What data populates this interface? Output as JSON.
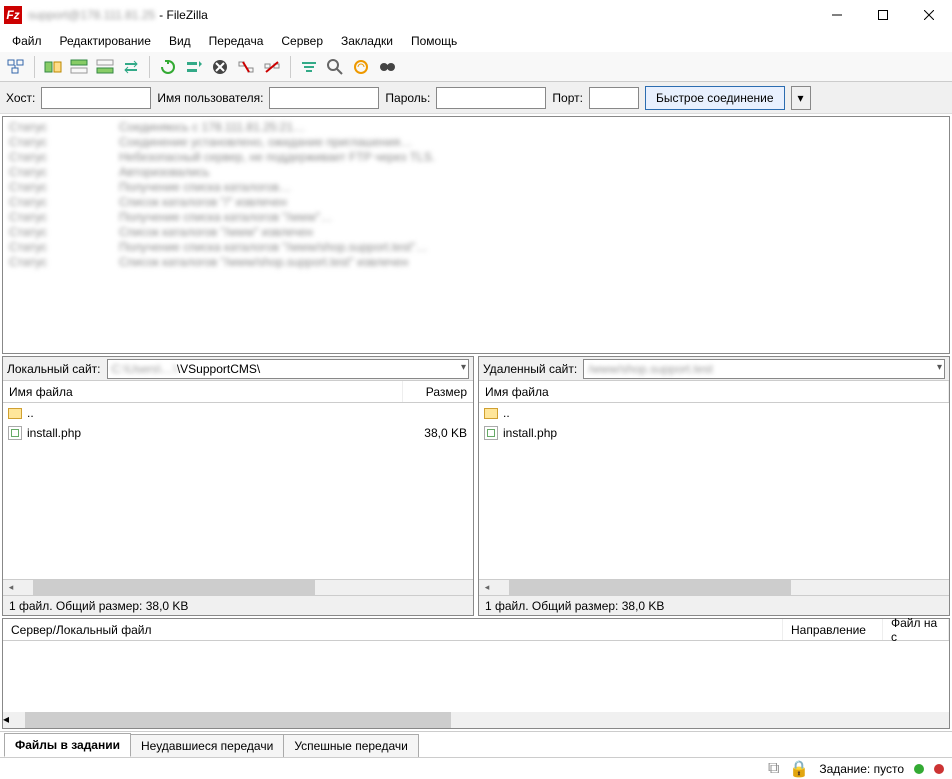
{
  "titlebar": {
    "app_name": "- FileZilla",
    "icon_text": "Fz"
  },
  "menubar": {
    "file": "Файл",
    "edit": "Редактирование",
    "view": "Вид",
    "transfer": "Передача",
    "server": "Сервер",
    "bookmarks": "Закладки",
    "help": "Помощь"
  },
  "quickconnect": {
    "host_label": "Хост:",
    "user_label": "Имя пользователя:",
    "pass_label": "Пароль:",
    "port_label": "Порт:",
    "button": "Быстрое соединение",
    "host": "",
    "user": "",
    "pass": "",
    "port": ""
  },
  "local": {
    "label": "Локальный сайт:",
    "path_hidden": "C:\\Users\\…\\",
    "path_visible": "\\VSupportCMS\\",
    "col_name": "Имя файла",
    "col_size": "Размер",
    "parent": "..",
    "file": "install.php",
    "file_size": "38,0 KB",
    "status": "1 файл. Общий размер: 38,0 KB"
  },
  "remote": {
    "label": "Удаленный сайт:",
    "path_hidden": "/www/shop.support.test",
    "col_name": "Имя файла",
    "parent": "..",
    "file": "install.php",
    "status": "1 файл. Общий размер: 38,0 KB"
  },
  "queue": {
    "col_server": "Сервер/Локальный файл",
    "col_direction": "Направление",
    "col_remote": "Файл на с",
    "tab_pending": "Файлы в задании",
    "tab_failed": "Неудавшиеся передачи",
    "tab_success": "Успешные передачи"
  },
  "statusbar": {
    "queue_label": "Задание: пусто"
  }
}
